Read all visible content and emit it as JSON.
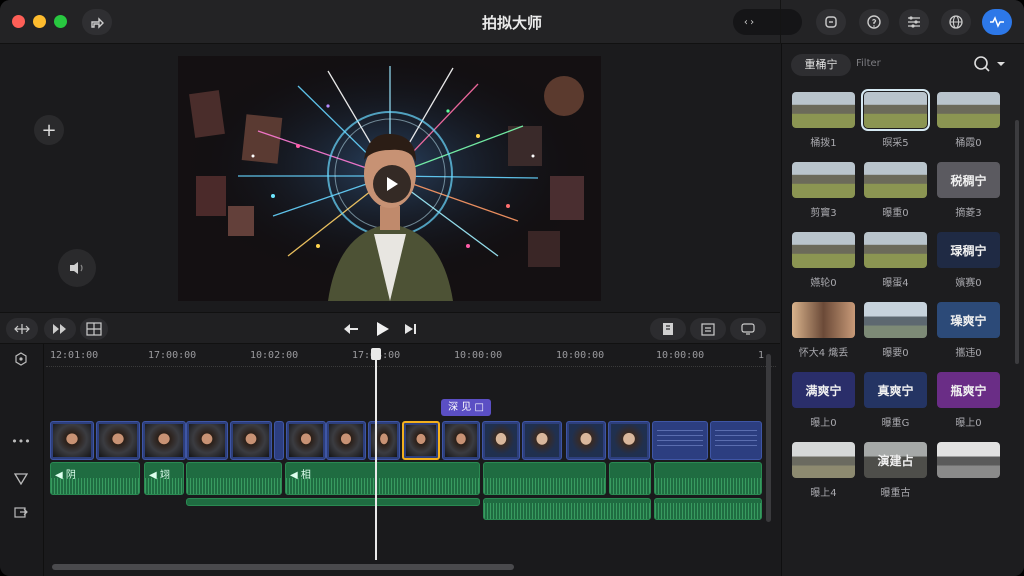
{
  "app": {
    "title": "拍拟大师"
  },
  "toolbar": {
    "code_label": "‹›"
  },
  "transport": {},
  "timeline": {
    "ticks": [
      "12:01:00",
      "17:00:00",
      "10:02:00",
      "17:04:00",
      "10:00:00",
      "10:00:00",
      "10:00:00",
      "1"
    ],
    "title_clip": "深 见 □",
    "audio_labels": [
      "◀ 阴",
      "◀ 翊",
      "◀ 相"
    ]
  },
  "panel": {
    "tab": "重桶宁",
    "filter_label": "Filter",
    "effects": [
      {
        "label": "桶拨1",
        "word": "",
        "style": "land"
      },
      {
        "label": "暝采5",
        "word": "",
        "style": "land",
        "selected": true
      },
      {
        "label": "桶霞0",
        "word": "",
        "style": "land"
      },
      {
        "label": "剪竇3",
        "word": "",
        "style": "land"
      },
      {
        "label": "曝重0",
        "word": "",
        "style": "land"
      },
      {
        "label": "摘菱3",
        "word": "税稠宁",
        "style": "gray"
      },
      {
        "label": "嬿轮0",
        "word": "",
        "style": "land"
      },
      {
        "label": "曝蛋4",
        "word": "",
        "style": "land"
      },
      {
        "label": "嬪赛0",
        "word": "琭稠宁",
        "style": "navy"
      },
      {
        "label": "怀大4 熾丢",
        "word": "",
        "style": "warm"
      },
      {
        "label": "曝要0",
        "word": "",
        "style": "cool"
      },
      {
        "label": "攜违0",
        "word": "璪爽宁",
        "style": "blue"
      },
      {
        "label": "曝上0",
        "word": "满爽宁",
        "style": "indigo"
      },
      {
        "label": "曝重G",
        "word": "真爽宁",
        "style": "indigo2"
      },
      {
        "label": "曝上0",
        "word": "瓶爽宁",
        "style": "purple"
      },
      {
        "label": "曝上4",
        "word": "",
        "style": "dusk"
      },
      {
        "label": "曝重古",
        "word": "演建占",
        "style": "dusk2"
      },
      {
        "label": "",
        "word": "",
        "style": "bw"
      }
    ]
  },
  "colors": {
    "accent": "#2d78e8",
    "selected_clip": "#f2b01e",
    "audio": "#1f6c41",
    "video": "#2d3f7c"
  }
}
